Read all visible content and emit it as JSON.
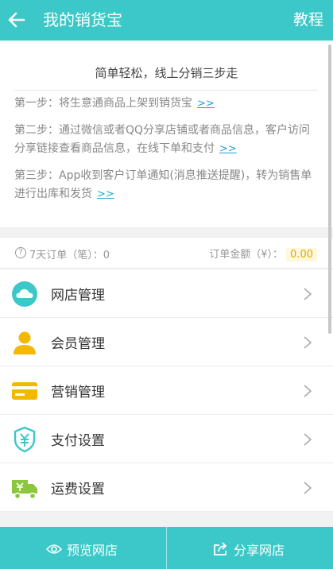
{
  "header": {
    "title": "我的销货宝",
    "tutorial_label": "教程"
  },
  "guide": {
    "title": "简单轻松，线上分销三步走",
    "steps": [
      {
        "text": "第一步：将生意通商品上架到销货宝",
        "link": ">>"
      },
      {
        "text": "第二步：通过微信或者QQ分享店铺或者商品信息，客户访问分享链接查看商品信息，在线下单和支付",
        "link": ">>"
      },
      {
        "text": "第三步：App收到客户订单通知(消息推送提醒)，转为销售单进行出库和发货",
        "link": ">>"
      }
    ]
  },
  "stats": {
    "help_glyph": "?",
    "orders_label": "7天订单（笔）：",
    "orders_value": "0",
    "amount_label": "订单金额（¥）：",
    "amount_value": "0.00"
  },
  "menu": [
    {
      "label": "网店管理",
      "icon": "cloud-icon"
    },
    {
      "label": "会员管理",
      "icon": "person-icon"
    },
    {
      "label": "营销管理",
      "icon": "card-icon"
    },
    {
      "label": "支付设置",
      "icon": "yuan-shield-icon"
    },
    {
      "label": "运费设置",
      "icon": "delivery-truck-icon"
    }
  ],
  "bottom": {
    "preview_label": "预览网店",
    "share_label": "分享网店"
  },
  "colors": {
    "brand": "#3cc8c8",
    "link": "#2a9fd6",
    "amount": "#e0a800"
  }
}
